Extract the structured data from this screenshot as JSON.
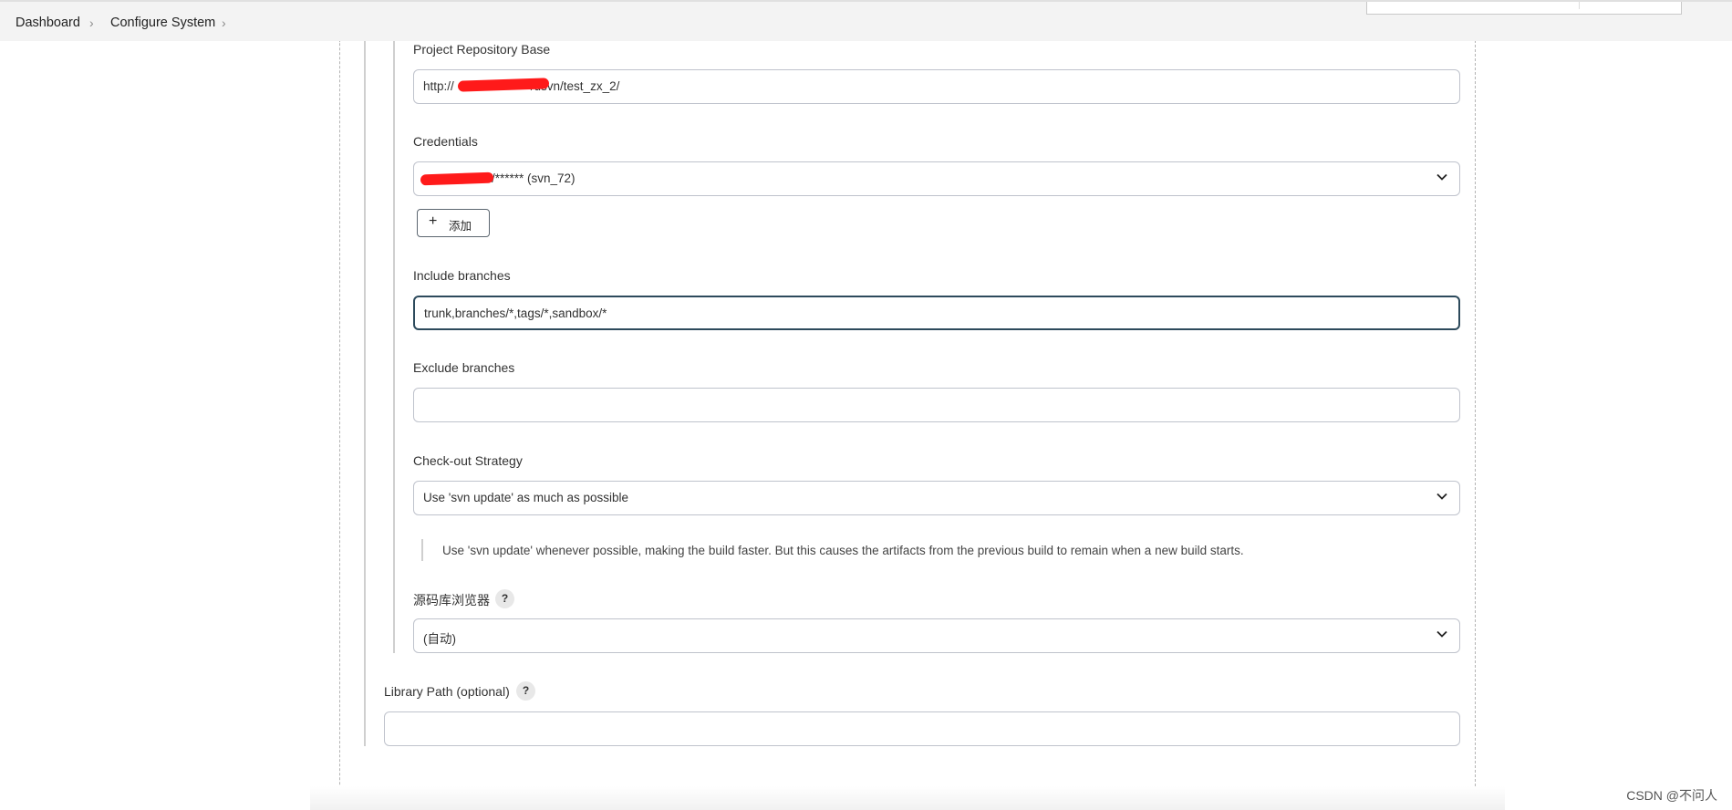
{
  "breadcrumb": {
    "items": [
      "Dashboard",
      "Configure System"
    ]
  },
  "form": {
    "repo_base": {
      "label": "Project Repository Base",
      "value_prefix": "http://",
      "value_suffix": "/usvn/test_zx_2/"
    },
    "credentials": {
      "label": "Credentials",
      "value": "/****** (svn_72)",
      "add_button": "添加"
    },
    "include_branches": {
      "label": "Include branches",
      "value": "trunk,branches/*,tags/*,sandbox/*"
    },
    "exclude_branches": {
      "label": "Exclude branches",
      "value": ""
    },
    "checkout_strategy": {
      "label": "Check-out Strategy",
      "value": "Use 'svn update' as much as possible",
      "description": "Use 'svn update' whenever possible, making the build faster. But this causes the artifacts from the previous build to remain when a new build starts."
    },
    "repo_browser": {
      "label": "源码库浏览器",
      "value": "(自动)",
      "help": "?"
    },
    "library_path": {
      "label": "Library Path (optional)",
      "value": "",
      "help": "?"
    }
  },
  "watermark": "CSDN @不问人"
}
